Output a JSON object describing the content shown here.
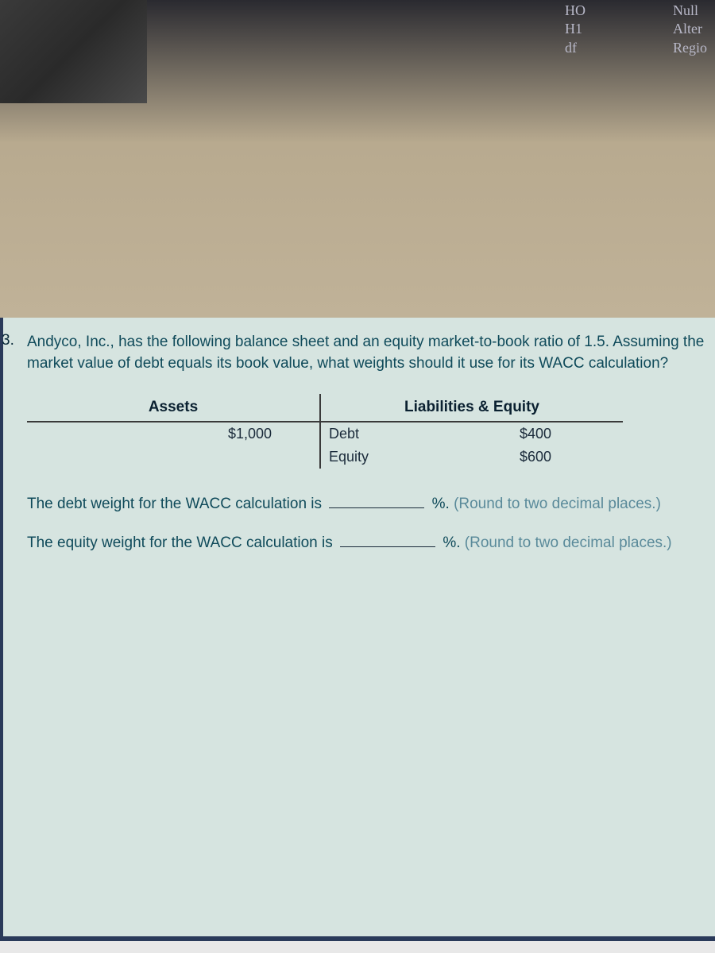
{
  "top_labels": {
    "col1": [
      "HO",
      "H1",
      "df"
    ],
    "col2": [
      "Null",
      "Alter",
      "Regio"
    ]
  },
  "question": {
    "number": "3.",
    "text": "Andyco, Inc., has the following balance sheet and an equity market-to-book ratio of 1.5. Assuming the market value of debt equals its book value, what weights should it use for its WACC calculation?"
  },
  "table": {
    "header_left": "Assets",
    "header_right": "Liabilities & Equity",
    "assets_value": "$1,000",
    "rows": [
      {
        "label": "Debt",
        "value": "$400"
      },
      {
        "label": "Equity",
        "value": "$600"
      }
    ]
  },
  "fill1": {
    "prefix": "The debt weight for the WACC calculation is",
    "suffix": "%.",
    "hint": "(Round to two decimal places.)"
  },
  "fill2": {
    "prefix": "The equity weight for the WACC calculation is",
    "suffix": "%.",
    "hint": "(Round to two decimal places.)"
  }
}
